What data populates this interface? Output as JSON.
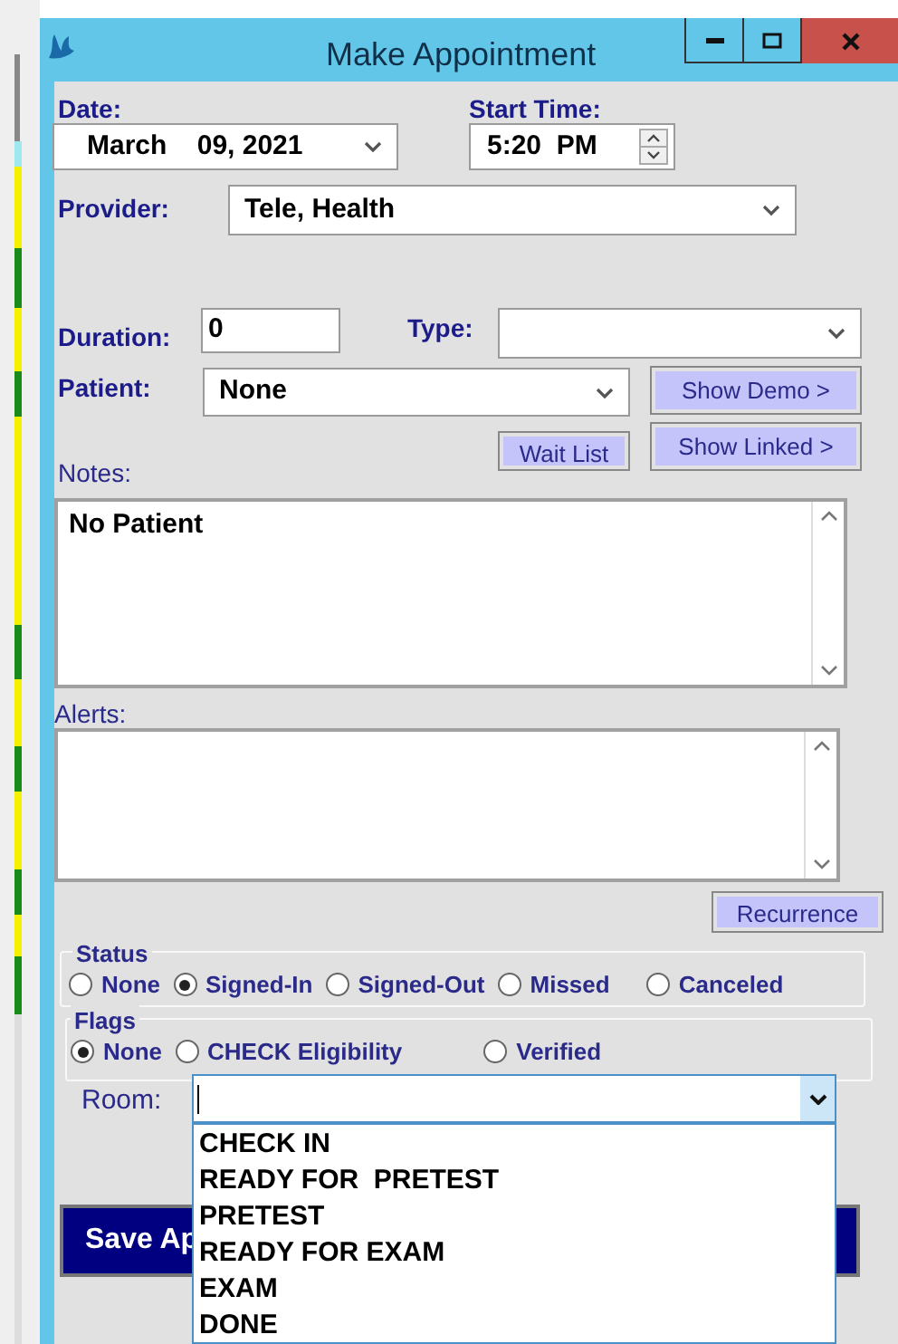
{
  "window": {
    "title": "Make Appointment"
  },
  "date": {
    "label": "Date:",
    "value": "March    09, 2021"
  },
  "start_time": {
    "label": "Start Time:",
    "value": "5:20  PM"
  },
  "provider": {
    "label": "Provider:",
    "value": "Tele, Health"
  },
  "duration": {
    "label": "Duration:",
    "value": "0"
  },
  "type": {
    "label": "Type:"
  },
  "patient": {
    "label": "Patient:",
    "value": "None"
  },
  "show_demo_button": "Show Demo >",
  "wait_list_button": "Wait List",
  "show_linked_button": "Show Linked >",
  "notes": {
    "label": "Notes:",
    "value": "No Patient"
  },
  "alerts": {
    "label": "Alerts:"
  },
  "recurrence_button": "Recurrence",
  "status": {
    "label": "Status",
    "options": [
      {
        "label": "None",
        "selected": false
      },
      {
        "label": "Signed-In",
        "selected": true
      },
      {
        "label": "Signed-Out",
        "selected": false
      },
      {
        "label": "Missed",
        "selected": false
      },
      {
        "label": "Canceled",
        "selected": false
      }
    ]
  },
  "flags": {
    "label": "Flags",
    "options": [
      {
        "label": "None",
        "selected": true
      },
      {
        "label": "CHECK Eligibility",
        "selected": false
      },
      {
        "label": "Verified",
        "selected": false
      }
    ]
  },
  "room": {
    "label": "Room:",
    "expanded": true,
    "options": [
      "CHECK IN",
      "READY FOR  PRETEST",
      "PRETEST",
      "READY FOR EXAM",
      "EXAM",
      "DONE"
    ]
  },
  "save_button": "Save Ap"
}
